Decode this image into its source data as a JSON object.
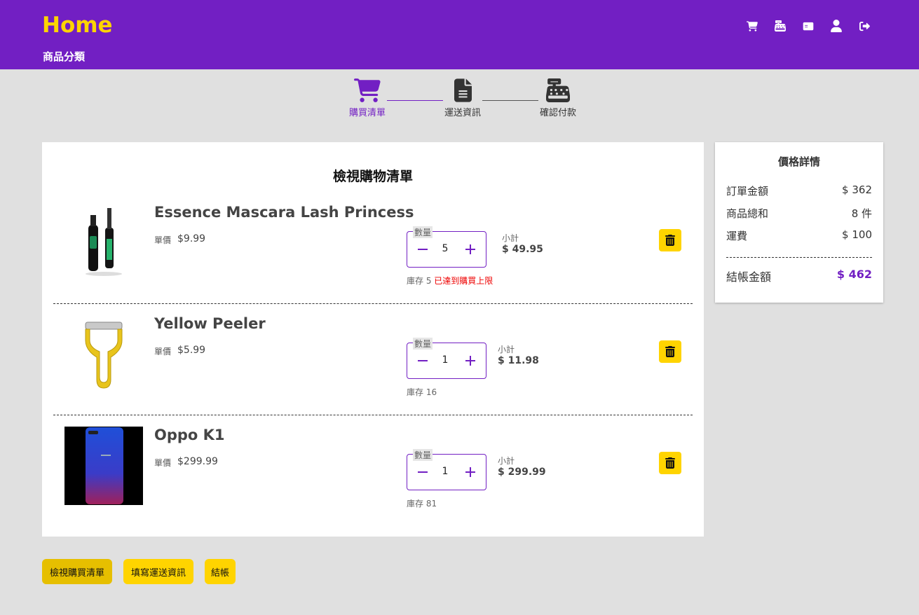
{
  "header": {
    "brand": "Home",
    "category": "商品分類",
    "icons": [
      "cart-icon",
      "cash-register-icon",
      "id-card-icon",
      "user-icon",
      "sign-out-icon"
    ]
  },
  "stepper": {
    "active_color": "#721fc3",
    "steps": [
      {
        "label": "購買清單",
        "icon": "cart-icon",
        "active": true
      },
      {
        "label": "運送資訊",
        "icon": "file-icon",
        "active": false
      },
      {
        "label": "確認付款",
        "icon": "cash-register-icon",
        "active": false
      }
    ]
  },
  "cart": {
    "title": "檢視購物清單",
    "unit_label": "單價",
    "qty_label": "數量",
    "subtotal_label": "小計",
    "items": [
      {
        "name": "Essence Mascara Lash Princess",
        "unit_price": "$9.99",
        "quantity": "5",
        "stock": "庫存 5",
        "stock_warning": "已達到購買上限",
        "subtotal": "$ 49.95"
      },
      {
        "name": "Yellow Peeler",
        "unit_price": "$5.99",
        "quantity": "1",
        "stock": "庫存 16",
        "stock_warning": "",
        "subtotal": "$ 11.98"
      },
      {
        "name": "Oppo K1",
        "unit_price": "$299.99",
        "quantity": "1",
        "stock": "庫存 81",
        "stock_warning": "",
        "subtotal": "$ 299.99"
      }
    ]
  },
  "price_details": {
    "title": "價格詳情",
    "rows": [
      {
        "label": "訂單金額",
        "value": "$ 362"
      },
      {
        "label": "商品總和",
        "value": "8 件"
      },
      {
        "label": "運費",
        "value": "$ 100"
      }
    ],
    "total_label": "結帳金額",
    "total_value": "$ 462"
  },
  "nav_buttons": [
    {
      "label": "檢視購買清單",
      "active": true
    },
    {
      "label": "填寫運送資訊",
      "active": false
    },
    {
      "label": "結帳",
      "active": false
    }
  ],
  "colors": {
    "brand_purple": "#721fc3",
    "accent_yellow": "#ffd400",
    "warning_red": "#e00000"
  }
}
